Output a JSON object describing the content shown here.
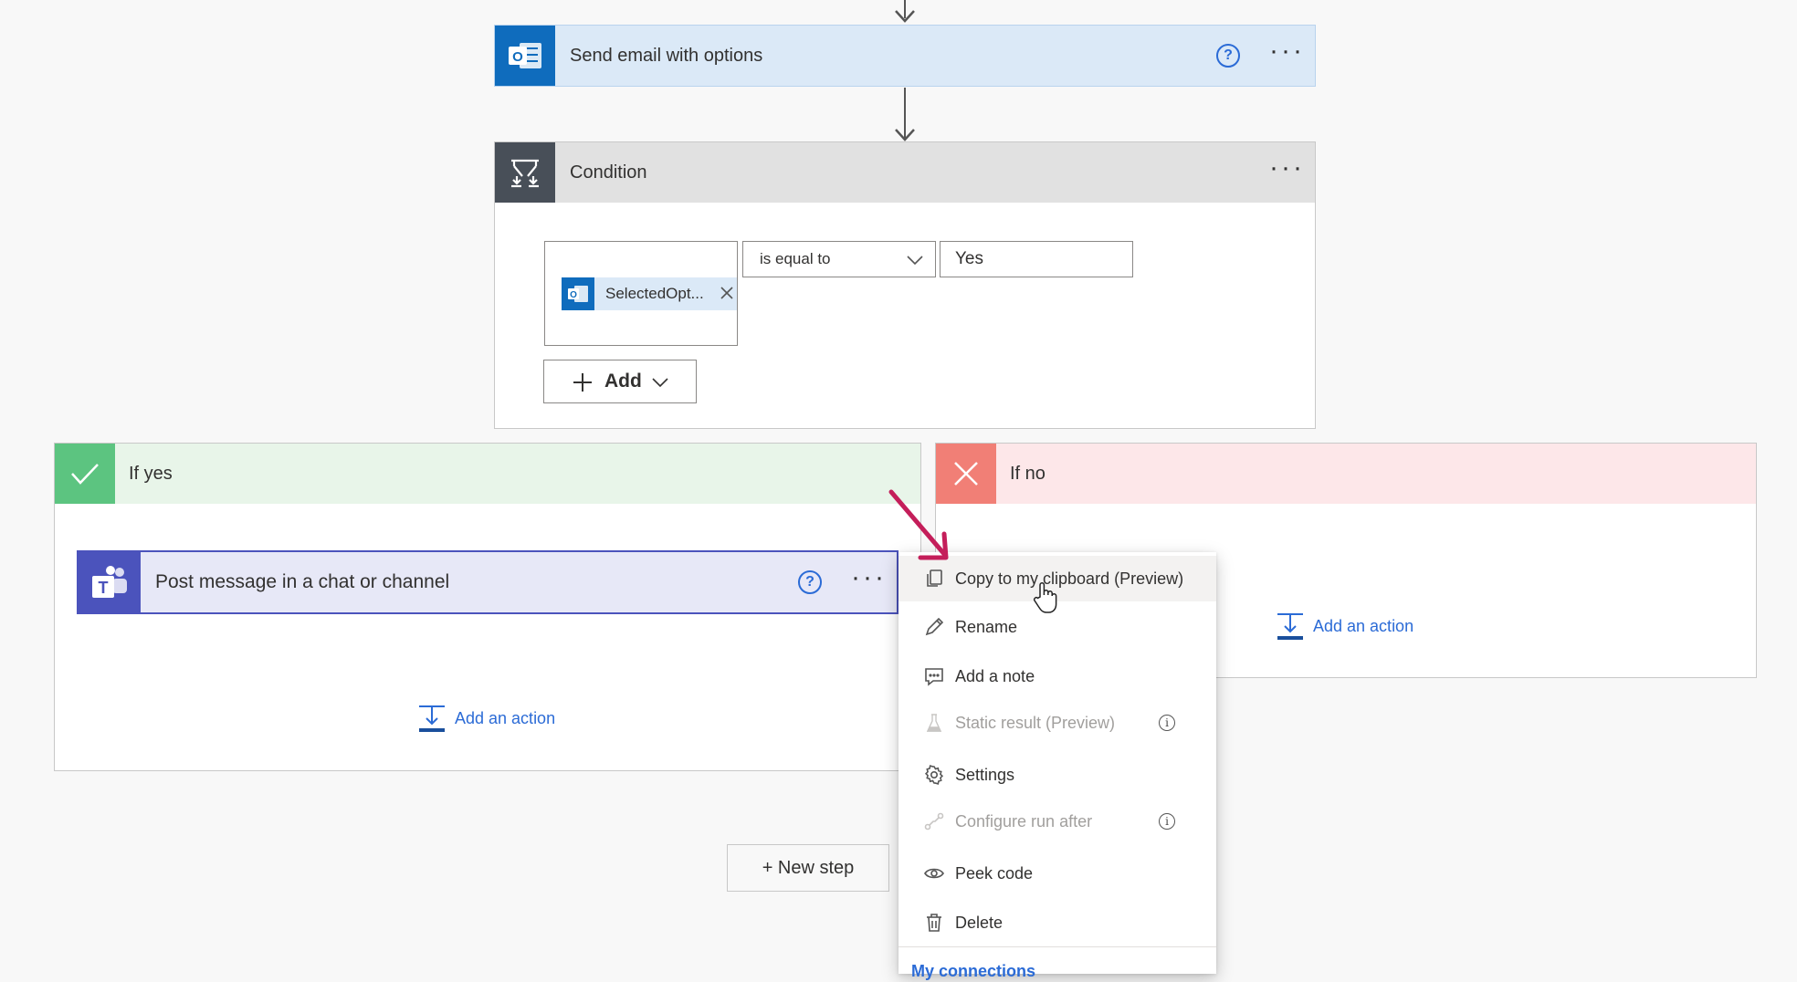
{
  "top_action": {
    "title": "Send email with options"
  },
  "condition": {
    "title": "Condition",
    "token_label": "SelectedOpt...",
    "operator_label": "is equal to",
    "value": "Yes",
    "add_label": "Add"
  },
  "if_yes": {
    "title": "If yes",
    "action_title": "Post message in a chat or channel",
    "add_action_label": "Add an action"
  },
  "if_no": {
    "title": "If no",
    "add_action_label": "Add an action"
  },
  "new_step_label": "+ New step",
  "context_menu": {
    "items": [
      {
        "label": "Copy to my clipboard (Preview)",
        "icon": "copy-icon",
        "enabled": true
      },
      {
        "label": "Rename",
        "icon": "pencil-icon",
        "enabled": true
      },
      {
        "label": "Add a note",
        "icon": "note-icon",
        "enabled": true
      },
      {
        "label": "Static result (Preview)",
        "icon": "flask-icon",
        "enabled": false
      },
      {
        "label": "Settings",
        "icon": "gear-icon",
        "enabled": true
      },
      {
        "label": "Configure run after",
        "icon": "run-after-icon",
        "enabled": false
      },
      {
        "label": "Peek code",
        "icon": "eye-icon",
        "enabled": true
      },
      {
        "label": "Delete",
        "icon": "trash-icon",
        "enabled": true
      }
    ],
    "footer_link": "My connections"
  },
  "colors": {
    "outlook_blue": "#0f6cbd",
    "action_header": "#dbe9f7",
    "condition_tile": "#484f58",
    "condition_header": "#e1e1e1",
    "yes_tile": "#5cc480",
    "yes_header": "#e8f5e9",
    "no_tile": "#f17f76",
    "no_header": "#fde7e9",
    "teams_purple": "#4b53bc",
    "teams_header": "#e7e8f7",
    "annotation_arrow": "#c41e5a",
    "link_blue": "#2b6bd6"
  }
}
